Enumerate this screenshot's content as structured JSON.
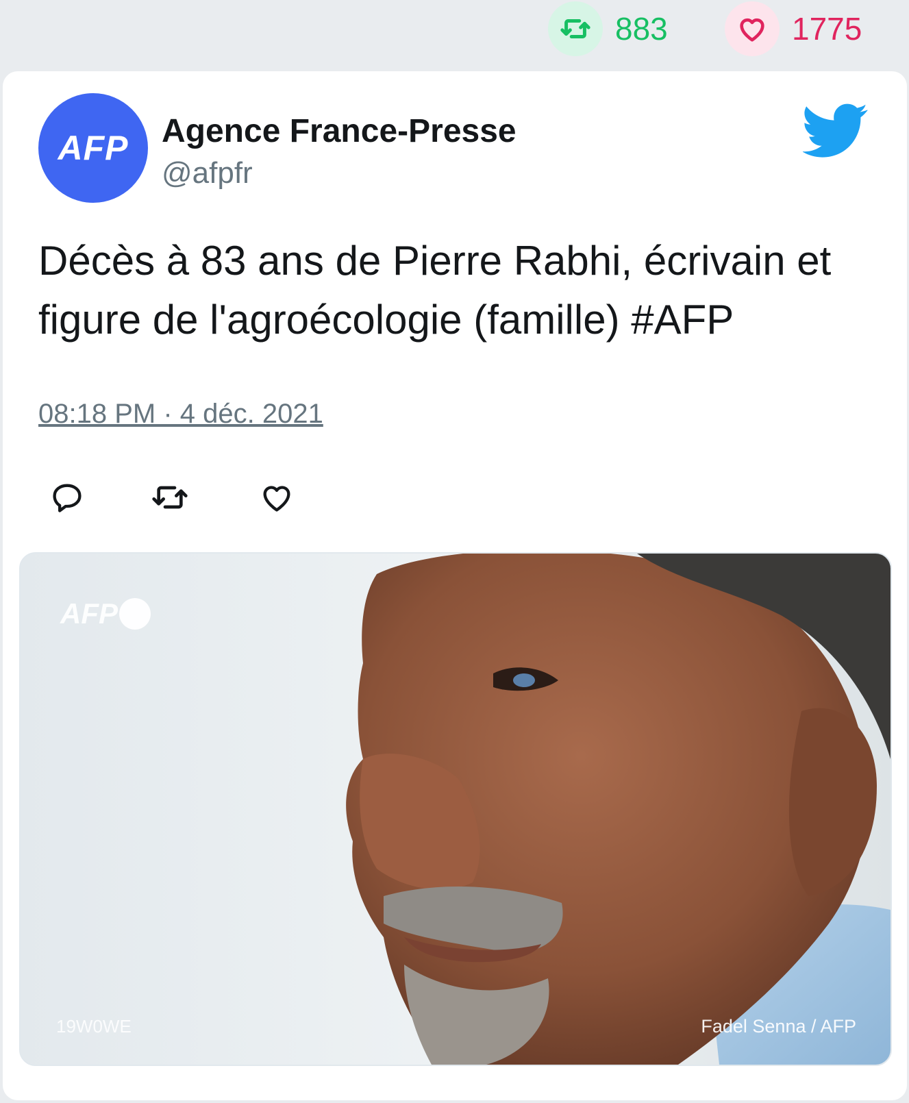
{
  "stats": {
    "retweets": "883",
    "likes": "1775"
  },
  "tweet": {
    "author_name": "Agence France-Presse",
    "author_handle": "@afpfr",
    "avatar_text": "AFP",
    "text": "Décès à 83 ans de Pierre Rabhi, écrivain et figure de l'agroécologie (famille) #AFP",
    "timestamp": "08:18 PM · 4 déc. 2021"
  },
  "media": {
    "watermark": "AFP",
    "photo_code": "19W0WE",
    "credit": "Fadel Senna / AFP"
  },
  "icons": {
    "retweet": "retweet-icon",
    "like": "heart-icon",
    "reply": "reply-icon",
    "brand": "twitter-bird-icon"
  },
  "colors": {
    "retweet": "#17bf63",
    "like": "#e0245e",
    "avatar": "#3f66f2",
    "twitter_blue": "#1da1f2",
    "muted_text": "#66757f"
  }
}
